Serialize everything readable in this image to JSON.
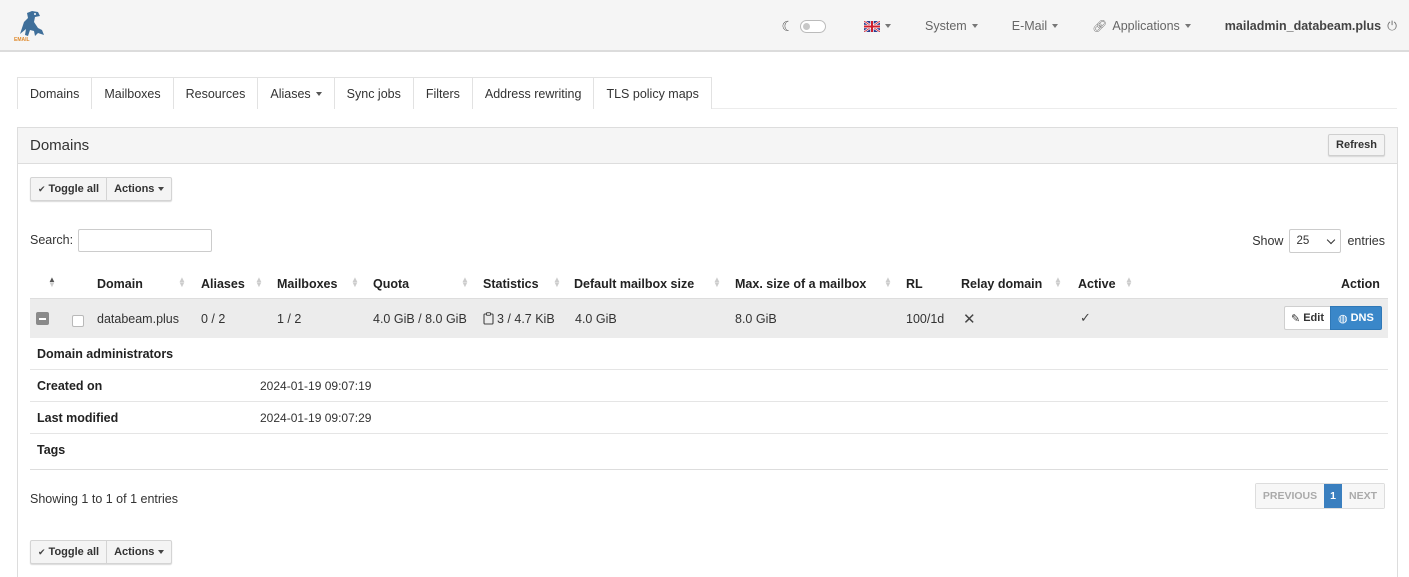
{
  "navbar": {
    "logo_text": "EMAIL",
    "language": "English",
    "menu": [
      {
        "label": "System"
      },
      {
        "label": "E-Mail"
      },
      {
        "label": "Applications"
      }
    ],
    "user": "mailadmin_databeam.plus"
  },
  "tabs": [
    {
      "label": "Domains"
    },
    {
      "label": "Mailboxes"
    },
    {
      "label": "Resources"
    },
    {
      "label": "Aliases"
    },
    {
      "label": "Sync jobs"
    },
    {
      "label": "Filters"
    },
    {
      "label": "Address rewriting"
    },
    {
      "label": "TLS policy maps"
    }
  ],
  "panel": {
    "title": "Domains",
    "refresh_label": "Refresh",
    "toggle_all_label": "Toggle all",
    "actions_label": "Actions",
    "search_label": "Search:",
    "search_value": "",
    "show_label": "Show",
    "show_value": "25",
    "entries_label": "entries"
  },
  "table": {
    "columns": [
      "Domain",
      "Aliases",
      "Mailboxes",
      "Quota",
      "Statistics",
      "Default mailbox size",
      "Max. size of a mailbox",
      "RL",
      "Relay domain",
      "Active",
      "Action"
    ],
    "rows": [
      {
        "domain": "databeam.plus",
        "aliases": "0 / 2",
        "mailboxes": "1 / 2",
        "quota": "4.0 GiB / 8.0 GiB",
        "statistics": "3 / 4.7 KiB",
        "default_mailbox_size": "4.0 GiB",
        "max_mailbox_size": "8.0 GiB",
        "rl": "100/1d",
        "relay_domain": "✕",
        "active": "✓",
        "edit_label": "Edit",
        "dns_label": "DNS"
      }
    ],
    "details": [
      {
        "label": "Domain administrators",
        "value": ""
      },
      {
        "label": "Created on",
        "value": "2024-01-19 09:07:19"
      },
      {
        "label": "Last modified",
        "value": "2024-01-19 09:07:29"
      },
      {
        "label": "Tags",
        "value": ""
      }
    ]
  },
  "footer": {
    "showing_text": "Showing 1 to 1 of 1 entries",
    "previous_label": "PREVIOUS",
    "page_label": "1",
    "next_label": "NEXT"
  },
  "colors": {
    "accent": "#3a87c9",
    "navbar_bg": "#f5f5f5",
    "row_highlight": "#ececec"
  },
  "icons": [
    "logo-dino-icon",
    "moon-icon",
    "uk-flag-icon",
    "link-icon",
    "power-icon",
    "check-icon",
    "sort-icon",
    "clipboard-icon",
    "pencil-icon",
    "globe-icon",
    "x-icon"
  ]
}
